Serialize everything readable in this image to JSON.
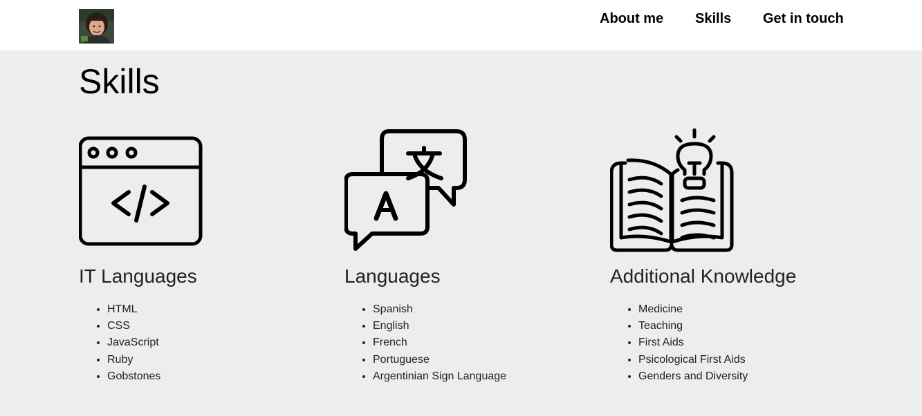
{
  "header": {
    "nav": [
      "About me",
      "Skills",
      "Get in touch"
    ]
  },
  "main": {
    "title": "Skills",
    "sections": [
      {
        "heading": "IT Languages",
        "icon": "code-window-icon",
        "items": [
          "HTML",
          "CSS",
          "JavaScript",
          "Ruby",
          "Gobstones"
        ]
      },
      {
        "heading": "Languages",
        "icon": "translate-icon",
        "items": [
          "Spanish",
          "English",
          "French",
          "Portuguese",
          "Argentinian Sign Language"
        ]
      },
      {
        "heading": "Additional Knowledge",
        "icon": "book-lightbulb-icon",
        "items": [
          "Medicine",
          "Teaching",
          "First Aids",
          "Psicological First Aids",
          "Genders and Diversity"
        ]
      }
    ]
  },
  "colors": {
    "header_bg": "#ffffff",
    "page_bg": "#ededed",
    "text": "#222222"
  }
}
